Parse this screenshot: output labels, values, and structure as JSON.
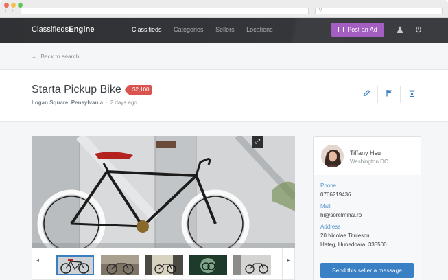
{
  "browser": {
    "dots": [
      {
        "color": "#ee6b5f"
      },
      {
        "color": "#f5be4f"
      },
      {
        "color": "#61c554"
      }
    ],
    "nav_arrows": "‹ ›",
    "url_plus": "+",
    "search_icon": "⚲"
  },
  "header": {
    "brand_regular": "Classifieds",
    "brand_bold": "Engine",
    "nav": [
      {
        "label": "Classifieds",
        "active": true
      },
      {
        "label": "Categories",
        "active": false
      },
      {
        "label": "Sellers",
        "active": false
      },
      {
        "label": "Locations",
        "active": false
      }
    ],
    "post_button": "Post an Ad",
    "user_icon": "user-icon",
    "power_icon": "power-icon",
    "accent": "#a45ec1"
  },
  "backbar": {
    "label": "Back to search"
  },
  "listing": {
    "title": "Starta Pickup Bike",
    "price": "$2,100",
    "location": "Logan Square, Pensylvania",
    "posted": "2 days ago",
    "price_color": "#d9534f"
  },
  "actions": [
    {
      "name": "edit-icon",
      "glyph": "✎"
    },
    {
      "name": "flag-icon",
      "glyph": "⚑"
    },
    {
      "name": "trash-icon",
      "glyph": "🗑"
    }
  ],
  "gallery": {
    "fullscreen_icon": "⤢",
    "prev": "◂",
    "next": "▸",
    "thumbs": [
      {
        "name": "thumb-1",
        "selected": true
      },
      {
        "name": "thumb-2",
        "selected": false
      },
      {
        "name": "thumb-3",
        "selected": false
      },
      {
        "name": "thumb-4",
        "selected": false
      },
      {
        "name": "thumb-5",
        "selected": false
      }
    ]
  },
  "seller": {
    "name": "Tiffany Hsu",
    "place": "Washington DC",
    "phone_label": "Phone",
    "phone": "0766219436",
    "mail_label": "Mail",
    "mail": "hi@sorelmihai.ro",
    "address_label": "Address",
    "address_line1": "20 Nicolae Titulescu,",
    "address_line2": "Hateg, Hunedoara, 335500",
    "message_button": "Send this seller a message",
    "button_color": "#3a80c4"
  }
}
